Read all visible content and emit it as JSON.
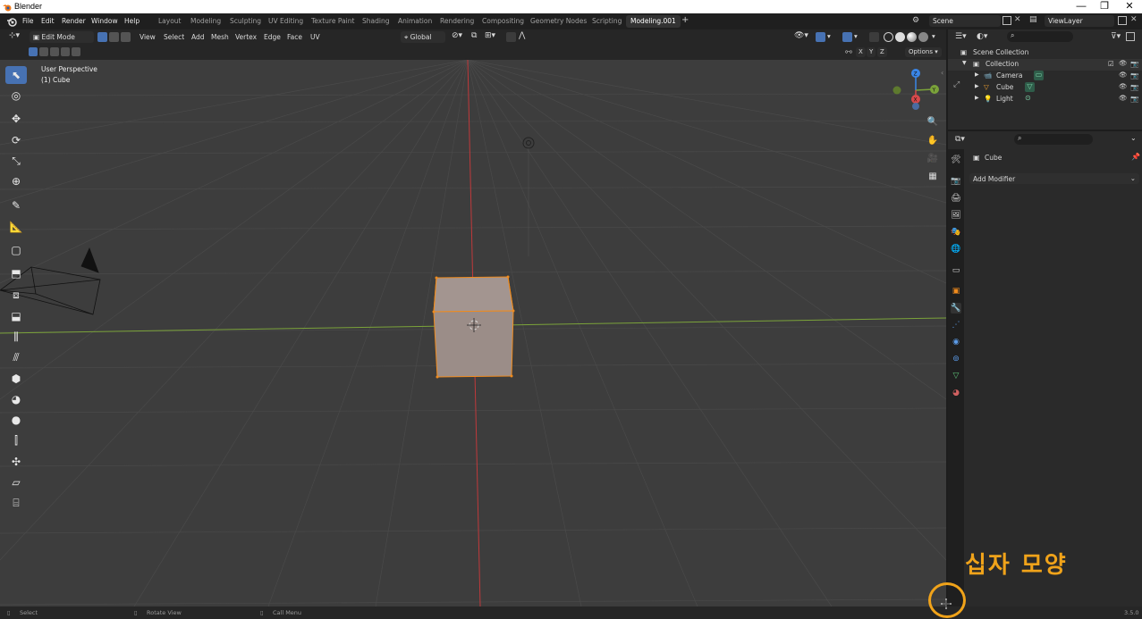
{
  "window": {
    "title": "Blender",
    "minimize": "—",
    "restore": "❐",
    "close": "✕"
  },
  "menu": [
    "File",
    "Edit",
    "Render",
    "Window",
    "Help"
  ],
  "workspaces": [
    "Layout",
    "Modeling",
    "Sculpting",
    "UV Editing",
    "Texture Paint",
    "Shading",
    "Animation",
    "Rendering",
    "Compositing",
    "Geometry Nodes",
    "Scripting",
    "Modeling.001"
  ],
  "active_workspace": "Modeling.001",
  "scene": {
    "name": "Scene",
    "view_layer": "ViewLayer"
  },
  "header3d": {
    "mode": "Edit Mode",
    "menus": [
      "View",
      "Select",
      "Add",
      "Mesh",
      "Vertex",
      "Edge",
      "Face",
      "UV"
    ],
    "transform_orientation": "Global",
    "axes": [
      "X",
      "Y",
      "Z"
    ],
    "options": "Options"
  },
  "viewport": {
    "view_name": "User Perspective",
    "object_label": "(1) Cube"
  },
  "gizmo": {
    "x": "X",
    "y": "Y",
    "z": "Z"
  },
  "outliner": {
    "root": "Scene Collection",
    "collection": "Collection",
    "items": [
      "Camera",
      "Cube",
      "Light"
    ]
  },
  "properties": {
    "object_name": "Cube",
    "add_modifier": "Add Modifier"
  },
  "statusbar": {
    "select": "Select",
    "rotate": "Rotate View",
    "menu": "Call Menu",
    "version": "3.5.0"
  },
  "annotation": "십자 모양",
  "colors": {
    "accent": "#4772b3",
    "annotation": "#f0a31a",
    "selected_edge": "#f08b1d",
    "x_axis": "#d8494b",
    "y_axis": "#7ba33a",
    "z_axis": "#3a86e8"
  }
}
